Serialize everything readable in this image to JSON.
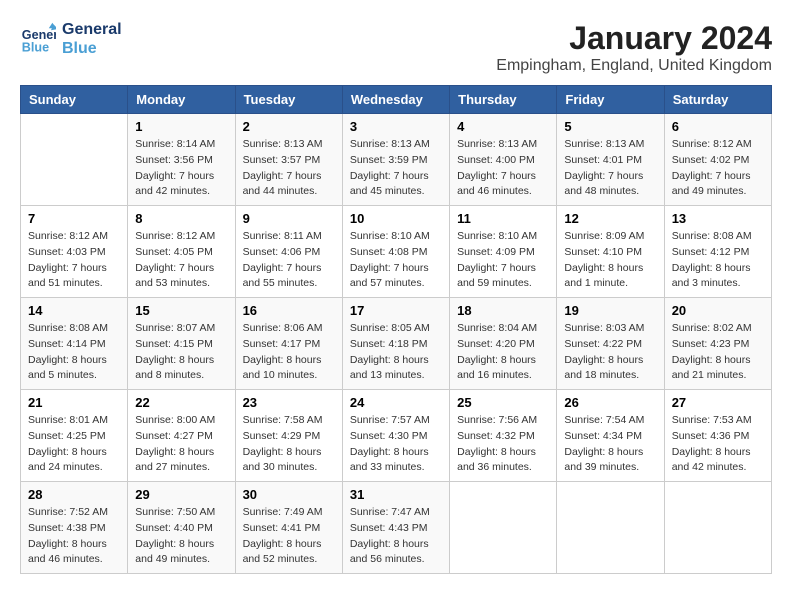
{
  "header": {
    "logo_line1": "General",
    "logo_line2": "Blue",
    "month": "January 2024",
    "location": "Empingham, England, United Kingdom"
  },
  "days_of_week": [
    "Sunday",
    "Monday",
    "Tuesday",
    "Wednesday",
    "Thursday",
    "Friday",
    "Saturday"
  ],
  "weeks": [
    [
      {
        "day": "",
        "info": ""
      },
      {
        "day": "1",
        "info": "Sunrise: 8:14 AM\nSunset: 3:56 PM\nDaylight: 7 hours\nand 42 minutes."
      },
      {
        "day": "2",
        "info": "Sunrise: 8:13 AM\nSunset: 3:57 PM\nDaylight: 7 hours\nand 44 minutes."
      },
      {
        "day": "3",
        "info": "Sunrise: 8:13 AM\nSunset: 3:59 PM\nDaylight: 7 hours\nand 45 minutes."
      },
      {
        "day": "4",
        "info": "Sunrise: 8:13 AM\nSunset: 4:00 PM\nDaylight: 7 hours\nand 46 minutes."
      },
      {
        "day": "5",
        "info": "Sunrise: 8:13 AM\nSunset: 4:01 PM\nDaylight: 7 hours\nand 48 minutes."
      },
      {
        "day": "6",
        "info": "Sunrise: 8:12 AM\nSunset: 4:02 PM\nDaylight: 7 hours\nand 49 minutes."
      }
    ],
    [
      {
        "day": "7",
        "info": "Sunrise: 8:12 AM\nSunset: 4:03 PM\nDaylight: 7 hours\nand 51 minutes."
      },
      {
        "day": "8",
        "info": "Sunrise: 8:12 AM\nSunset: 4:05 PM\nDaylight: 7 hours\nand 53 minutes."
      },
      {
        "day": "9",
        "info": "Sunrise: 8:11 AM\nSunset: 4:06 PM\nDaylight: 7 hours\nand 55 minutes."
      },
      {
        "day": "10",
        "info": "Sunrise: 8:10 AM\nSunset: 4:08 PM\nDaylight: 7 hours\nand 57 minutes."
      },
      {
        "day": "11",
        "info": "Sunrise: 8:10 AM\nSunset: 4:09 PM\nDaylight: 7 hours\nand 59 minutes."
      },
      {
        "day": "12",
        "info": "Sunrise: 8:09 AM\nSunset: 4:10 PM\nDaylight: 8 hours\nand 1 minute."
      },
      {
        "day": "13",
        "info": "Sunrise: 8:08 AM\nSunset: 4:12 PM\nDaylight: 8 hours\nand 3 minutes."
      }
    ],
    [
      {
        "day": "14",
        "info": "Sunrise: 8:08 AM\nSunset: 4:14 PM\nDaylight: 8 hours\nand 5 minutes."
      },
      {
        "day": "15",
        "info": "Sunrise: 8:07 AM\nSunset: 4:15 PM\nDaylight: 8 hours\nand 8 minutes."
      },
      {
        "day": "16",
        "info": "Sunrise: 8:06 AM\nSunset: 4:17 PM\nDaylight: 8 hours\nand 10 minutes."
      },
      {
        "day": "17",
        "info": "Sunrise: 8:05 AM\nSunset: 4:18 PM\nDaylight: 8 hours\nand 13 minutes."
      },
      {
        "day": "18",
        "info": "Sunrise: 8:04 AM\nSunset: 4:20 PM\nDaylight: 8 hours\nand 16 minutes."
      },
      {
        "day": "19",
        "info": "Sunrise: 8:03 AM\nSunset: 4:22 PM\nDaylight: 8 hours\nand 18 minutes."
      },
      {
        "day": "20",
        "info": "Sunrise: 8:02 AM\nSunset: 4:23 PM\nDaylight: 8 hours\nand 21 minutes."
      }
    ],
    [
      {
        "day": "21",
        "info": "Sunrise: 8:01 AM\nSunset: 4:25 PM\nDaylight: 8 hours\nand 24 minutes."
      },
      {
        "day": "22",
        "info": "Sunrise: 8:00 AM\nSunset: 4:27 PM\nDaylight: 8 hours\nand 27 minutes."
      },
      {
        "day": "23",
        "info": "Sunrise: 7:58 AM\nSunset: 4:29 PM\nDaylight: 8 hours\nand 30 minutes."
      },
      {
        "day": "24",
        "info": "Sunrise: 7:57 AM\nSunset: 4:30 PM\nDaylight: 8 hours\nand 33 minutes."
      },
      {
        "day": "25",
        "info": "Sunrise: 7:56 AM\nSunset: 4:32 PM\nDaylight: 8 hours\nand 36 minutes."
      },
      {
        "day": "26",
        "info": "Sunrise: 7:54 AM\nSunset: 4:34 PM\nDaylight: 8 hours\nand 39 minutes."
      },
      {
        "day": "27",
        "info": "Sunrise: 7:53 AM\nSunset: 4:36 PM\nDaylight: 8 hours\nand 42 minutes."
      }
    ],
    [
      {
        "day": "28",
        "info": "Sunrise: 7:52 AM\nSunset: 4:38 PM\nDaylight: 8 hours\nand 46 minutes."
      },
      {
        "day": "29",
        "info": "Sunrise: 7:50 AM\nSunset: 4:40 PM\nDaylight: 8 hours\nand 49 minutes."
      },
      {
        "day": "30",
        "info": "Sunrise: 7:49 AM\nSunset: 4:41 PM\nDaylight: 8 hours\nand 52 minutes."
      },
      {
        "day": "31",
        "info": "Sunrise: 7:47 AM\nSunset: 4:43 PM\nDaylight: 8 hours\nand 56 minutes."
      },
      {
        "day": "",
        "info": ""
      },
      {
        "day": "",
        "info": ""
      },
      {
        "day": "",
        "info": ""
      }
    ]
  ]
}
